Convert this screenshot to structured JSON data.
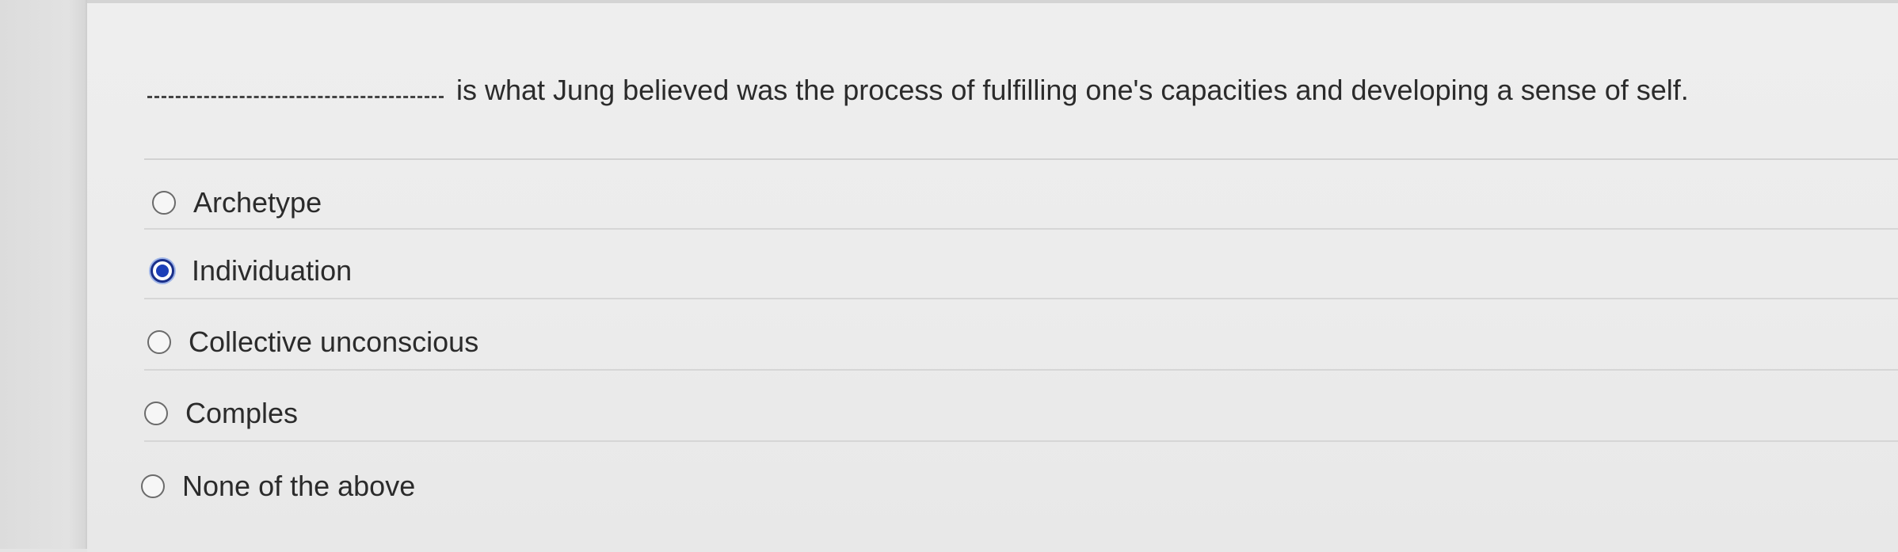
{
  "question": {
    "text": "is what Jung believed was the process of fulfilling one's capacities and developing a sense of self."
  },
  "options": [
    {
      "label": "Archetype",
      "selected": false
    },
    {
      "label": "Individuation",
      "selected": true
    },
    {
      "label": "Collective unconscious",
      "selected": false
    },
    {
      "label": "Comples",
      "selected": false
    },
    {
      "label": "None of the above",
      "selected": false
    }
  ],
  "colors": {
    "selected_radio": "#1c3fb8",
    "background": "#ececec"
  }
}
